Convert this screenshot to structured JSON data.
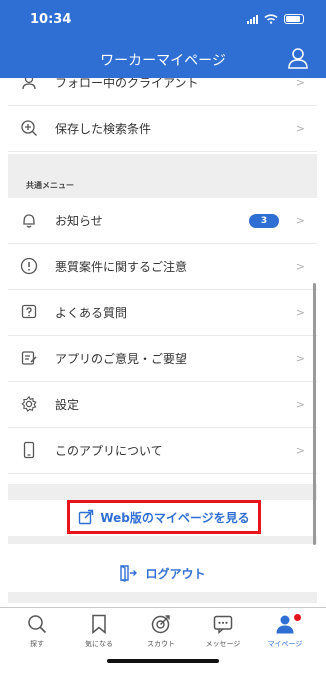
{
  "status_bar": {
    "time": "10:34"
  },
  "header": {
    "title": "ワーカーマイページ"
  },
  "menu_top": [
    {
      "label": "フォロー中のクライアント",
      "icon": "person-icon"
    },
    {
      "label": "保存した検索条件",
      "icon": "search-plus-icon"
    }
  ],
  "common_menu": {
    "title": "共通メニュー",
    "items": [
      {
        "label": "お知らせ",
        "icon": "bell-icon",
        "badge": "3"
      },
      {
        "label": "悪質案件に関するご注意",
        "icon": "warning-icon"
      },
      {
        "label": "よくある質問",
        "icon": "question-icon"
      },
      {
        "label": "アプリのご意見・ご要望",
        "icon": "edit-note-icon"
      },
      {
        "label": "設定",
        "icon": "gear-icon"
      },
      {
        "label": "このアプリについて",
        "icon": "phone-icon"
      }
    ]
  },
  "web_link": {
    "label": "Web版のマイページを見る",
    "icon": "external-link-icon"
  },
  "logout": {
    "label": "ログアウト",
    "icon": "logout-icon"
  },
  "tabbar": [
    {
      "label": "探す",
      "icon": "search-icon"
    },
    {
      "label": "気になる",
      "icon": "bookmark-icon"
    },
    {
      "label": "スカウト",
      "icon": "target-icon"
    },
    {
      "label": "メッセージ",
      "icon": "chat-icon"
    },
    {
      "label": "マイページ",
      "icon": "user-icon",
      "active": true
    }
  ],
  "colors": {
    "primary": "#2f6fd3",
    "highlight": "#e8141c",
    "band": "#eeeeee"
  }
}
